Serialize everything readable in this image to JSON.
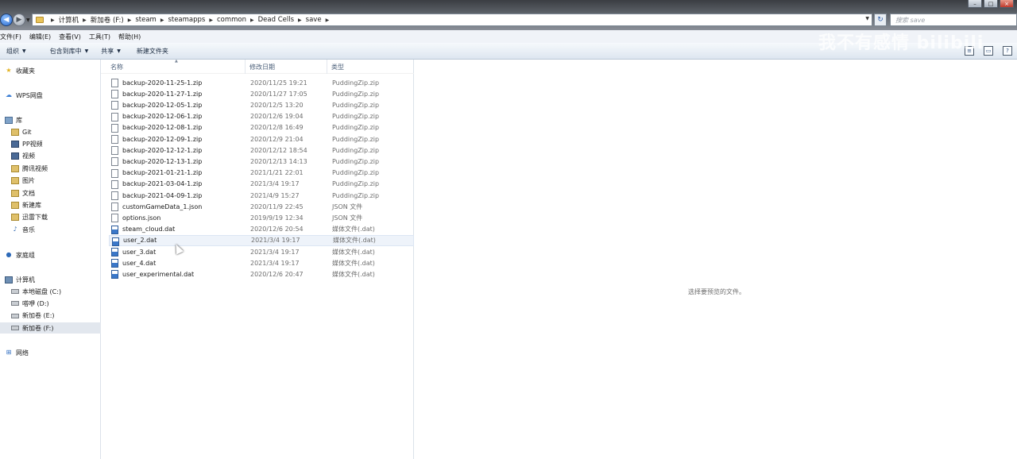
{
  "address": {
    "crumbs": [
      "计算机",
      "新加卷 (F:)",
      "steam",
      "steamapps",
      "common",
      "Dead Cells",
      "save"
    ]
  },
  "search": {
    "placeholder": "搜索 save"
  },
  "menu": [
    "文件(F)",
    "编辑(E)",
    "查看(V)",
    "工具(T)",
    "帮助(H)"
  ],
  "toolbar": {
    "organize": "组织",
    "include_library": "包含到库中",
    "share": "共享",
    "new_folder": "新建文件夹"
  },
  "watermark": "我不有感情 bilibili",
  "nav": {
    "favorites": "收藏夹",
    "wps": "WPS网盘",
    "libraries": "库",
    "library_items": [
      "Git",
      "PP视频",
      "视频",
      "腾讯视频",
      "图片",
      "文档",
      "新建库",
      "迅雷下载",
      "音乐"
    ],
    "homegroup": "家庭组",
    "computer": "计算机",
    "drives": [
      "本地磁盘 (C:)",
      "嗒咿 (D:)",
      "新加卷 (E:)",
      "新加卷 (F:)"
    ],
    "network": "网络"
  },
  "columns": {
    "name": "名称",
    "date": "修改日期",
    "type": "类型"
  },
  "files": [
    {
      "name": "backup-2020-11-25-1.zip",
      "date": "2020/11/25 19:21",
      "type": "PuddingZip.zip",
      "kind": "zip"
    },
    {
      "name": "backup-2020-11-27-1.zip",
      "date": "2020/11/27 17:05",
      "type": "PuddingZip.zip",
      "kind": "zip"
    },
    {
      "name": "backup-2020-12-05-1.zip",
      "date": "2020/12/5 13:20",
      "type": "PuddingZip.zip",
      "kind": "zip"
    },
    {
      "name": "backup-2020-12-06-1.zip",
      "date": "2020/12/6 19:04",
      "type": "PuddingZip.zip",
      "kind": "zip"
    },
    {
      "name": "backup-2020-12-08-1.zip",
      "date": "2020/12/8 16:49",
      "type": "PuddingZip.zip",
      "kind": "zip"
    },
    {
      "name": "backup-2020-12-09-1.zip",
      "date": "2020/12/9 21:04",
      "type": "PuddingZip.zip",
      "kind": "zip"
    },
    {
      "name": "backup-2020-12-12-1.zip",
      "date": "2020/12/12 18:54",
      "type": "PuddingZip.zip",
      "kind": "zip"
    },
    {
      "name": "backup-2020-12-13-1.zip",
      "date": "2020/12/13 14:13",
      "type": "PuddingZip.zip",
      "kind": "zip"
    },
    {
      "name": "backup-2021-01-21-1.zip",
      "date": "2021/1/21 22:01",
      "type": "PuddingZip.zip",
      "kind": "zip"
    },
    {
      "name": "backup-2021-03-04-1.zip",
      "date": "2021/3/4 19:17",
      "type": "PuddingZip.zip",
      "kind": "zip"
    },
    {
      "name": "backup-2021-04-09-1.zip",
      "date": "2021/4/9 15:27",
      "type": "PuddingZip.zip",
      "kind": "zip"
    },
    {
      "name": "customGameData_1.json",
      "date": "2020/11/9 22:45",
      "type": "JSON 文件",
      "kind": "json"
    },
    {
      "name": "options.json",
      "date": "2019/9/19 12:34",
      "type": "JSON 文件",
      "kind": "json"
    },
    {
      "name": "steam_cloud.dat",
      "date": "2020/12/6 20:54",
      "type": "媒体文件(.dat)",
      "kind": "dat"
    },
    {
      "name": "user_2.dat",
      "date": "2021/3/4 19:17",
      "type": "媒体文件(.dat)",
      "kind": "dat",
      "selected": true
    },
    {
      "name": "user_3.dat",
      "date": "2021/3/4 19:17",
      "type": "媒体文件(.dat)",
      "kind": "dat"
    },
    {
      "name": "user_4.dat",
      "date": "2021/3/4 19:17",
      "type": "媒体文件(.dat)",
      "kind": "dat"
    },
    {
      "name": "user_experimental.dat",
      "date": "2020/12/6 20:47",
      "type": "媒体文件(.dat)",
      "kind": "dat"
    }
  ],
  "preview": {
    "message": "选择要预览的文件。"
  }
}
